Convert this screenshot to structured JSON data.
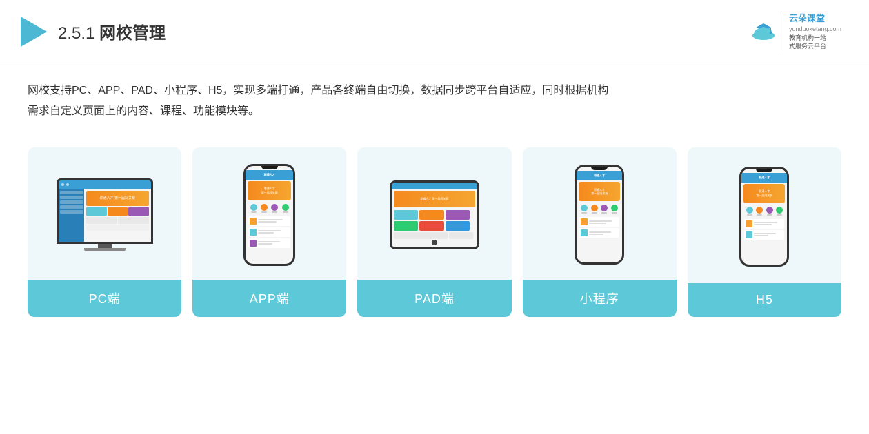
{
  "header": {
    "title_prefix": "2.5.1 ",
    "title_main": "网校管理",
    "brand_name_line1": "云朵课堂",
    "brand_name_line2": "yunduoketang.com",
    "brand_slogan1": "教育机构一站",
    "brand_slogan2": "式服务云平台"
  },
  "description": {
    "text1": "网校支持PC、APP、PAD、小程序、H5，实现多端打通，产品各终端自由切换，数据同步跨平台自适应，同时根据机构",
    "text2": "需求自定义页面上的内容、课程、功能模块等。"
  },
  "cards": [
    {
      "id": "pc",
      "label": "PC端",
      "device": "pc"
    },
    {
      "id": "app",
      "label": "APP端",
      "device": "phone"
    },
    {
      "id": "pad",
      "label": "PAD端",
      "device": "pad"
    },
    {
      "id": "miniprogram",
      "label": "小程序",
      "device": "phone"
    },
    {
      "id": "h5",
      "label": "H5",
      "device": "phone"
    }
  ],
  "colors": {
    "accent": "#5dc8d8",
    "card_bg": "#eef7fa",
    "triangle": "#4db8d4",
    "banner_orange": "#f5891d",
    "title_color": "#333"
  }
}
